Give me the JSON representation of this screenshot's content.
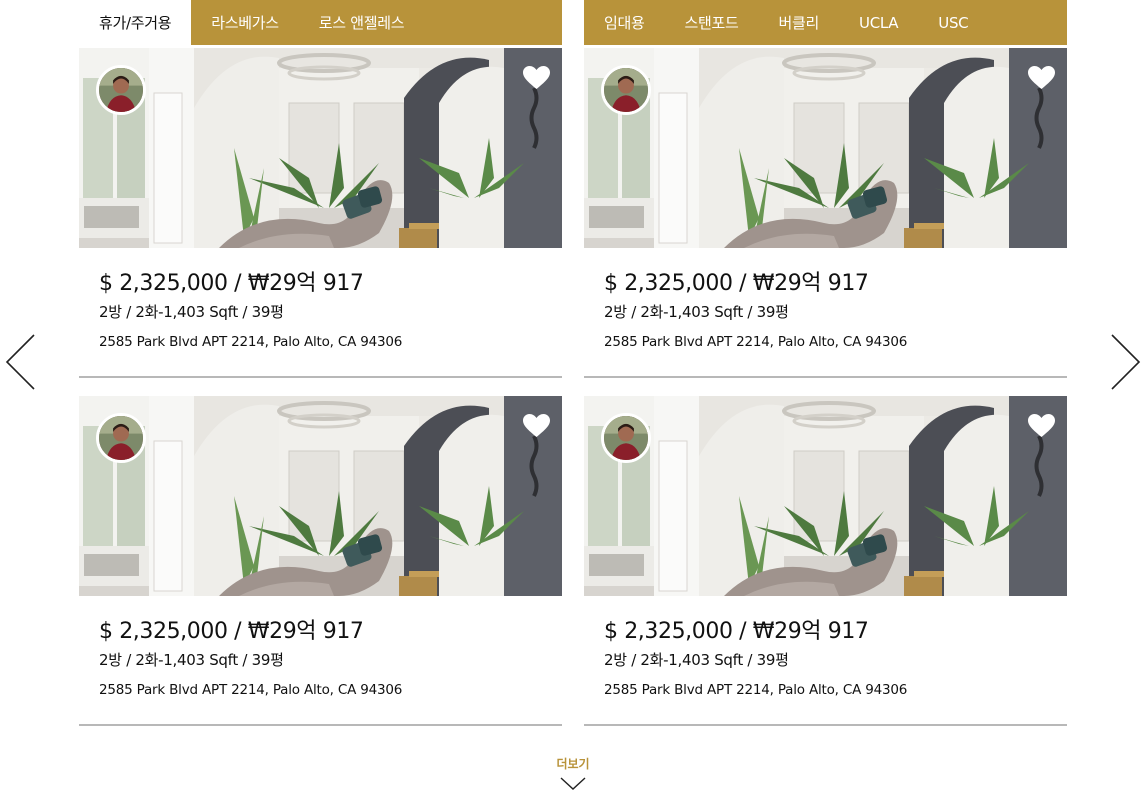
{
  "left_tabs": [
    {
      "label": "휴가/주거용",
      "active": true
    },
    {
      "label": "라스베가스",
      "active": false
    },
    {
      "label": "로스 앤젤레스",
      "active": false
    }
  ],
  "right_tabs": [
    {
      "label": "임대용",
      "active": false
    },
    {
      "label": "스탠포드",
      "active": false
    },
    {
      "label": "버클리",
      "active": false
    },
    {
      "label": "UCLA",
      "active": false
    },
    {
      "label": "USC",
      "active": false
    }
  ],
  "listings": [
    {
      "price": "$ 2,325,000 / ₩29억 917",
      "spec": "2방 / 2화-1,403 Sqft / 39평",
      "address": "2585 Park Blvd APT 2214, Palo Alto, CA 94306"
    },
    {
      "price": "$ 2,325,000 / ₩29억 917",
      "spec": "2방 / 2화-1,403 Sqft / 39평",
      "address": "2585 Park Blvd APT 2214, Palo Alto, CA 94306"
    },
    {
      "price": "$ 2,325,000 / ₩29억 917",
      "spec": "2방 / 2화-1,403 Sqft / 39평",
      "address": "2585 Park Blvd APT 2214, Palo Alto, CA 94306"
    },
    {
      "price": "$ 2,325,000 / ₩29억 917",
      "spec": "2방 / 2화-1,403 Sqft / 39평",
      "address": "2585 Park Blvd APT 2214, Palo Alto, CA 94306"
    }
  ],
  "more": {
    "label": "더보기"
  },
  "colors": {
    "accent": "#b8933a",
    "divider": "#b8b8b8"
  },
  "icons": {
    "prev": "chevron-left-icon",
    "next": "chevron-right-icon",
    "favorite": "heart-icon",
    "more": "chevron-down-icon"
  }
}
